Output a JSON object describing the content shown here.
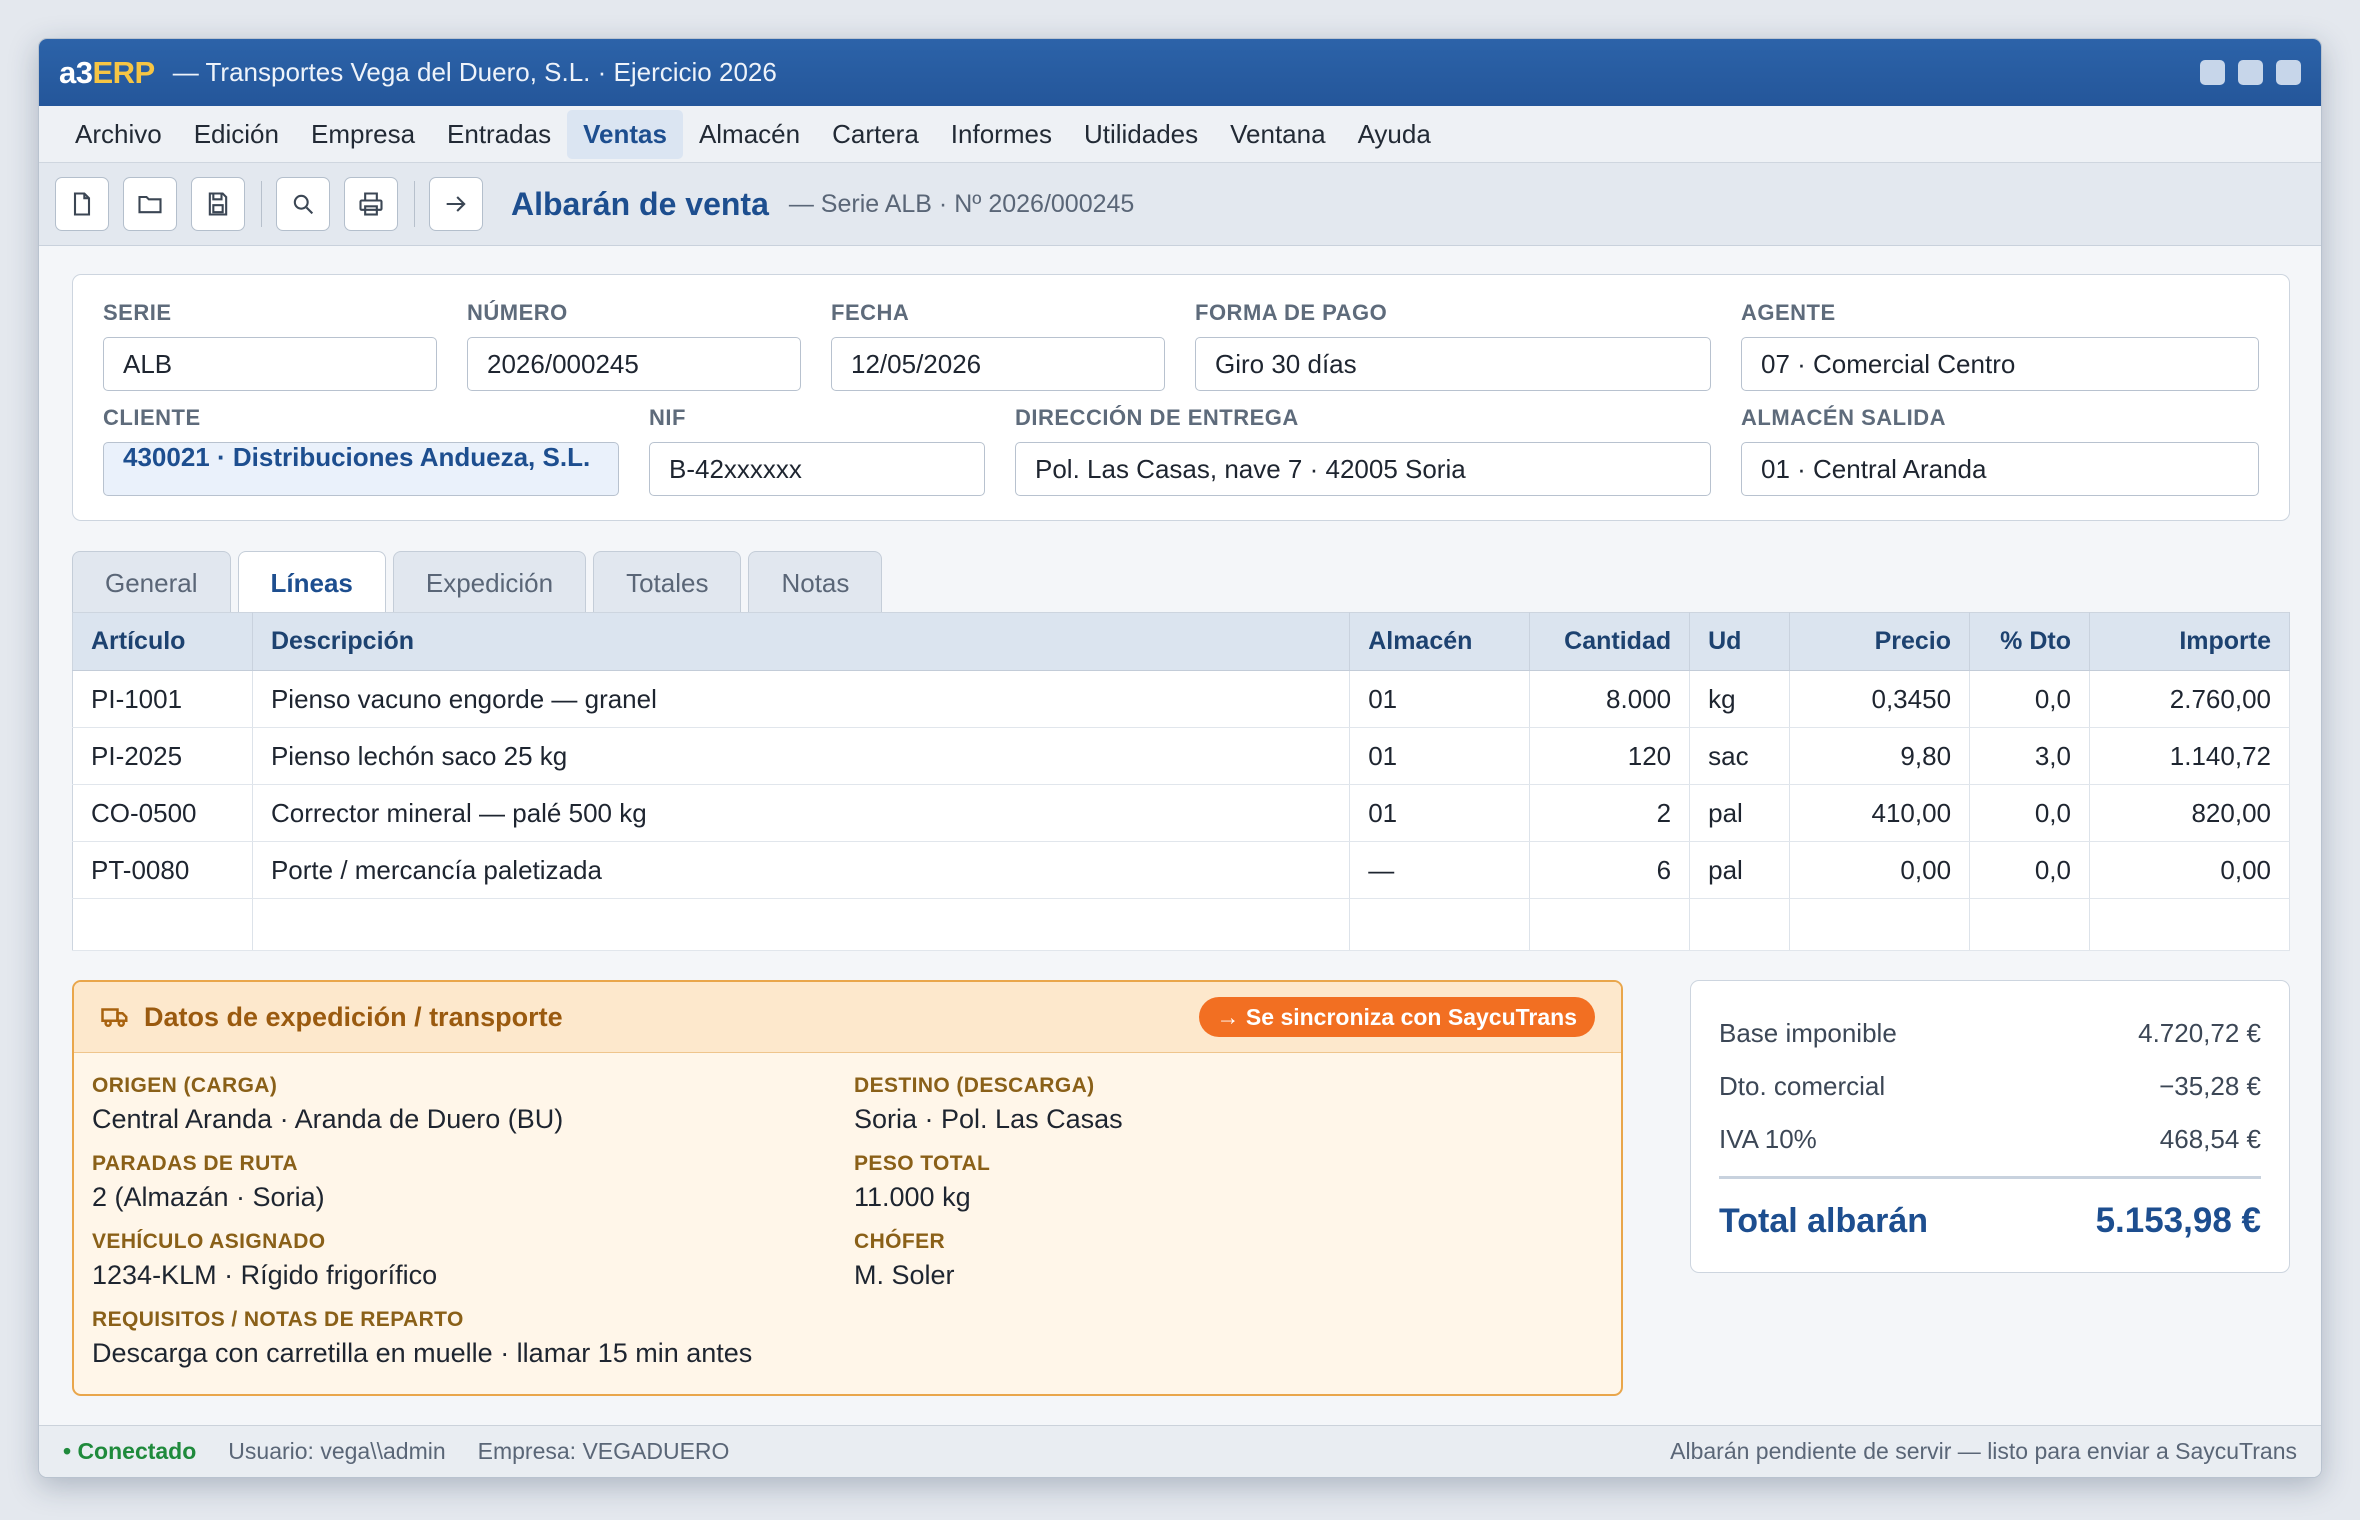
{
  "app": {
    "logo_a3": "a3",
    "logo_erp": "ERP",
    "window_title": "— Transportes Vega del Duero, S.L. · Ejercicio 2026"
  },
  "menu": [
    "Archivo",
    "Edición",
    "Empresa",
    "Entradas",
    "Ventas",
    "Almacén",
    "Cartera",
    "Informes",
    "Utilidades",
    "Ventana",
    "Ayuda"
  ],
  "menu_active": "Ventas",
  "toolbar": {
    "icons": [
      "new-document-icon",
      "open-folder-icon",
      "save-icon",
      "search-icon",
      "print-icon",
      "forward-arrow-icon"
    ],
    "doc_title": "Albarán de venta",
    "doc_sub": "— Serie ALB · Nº 2026/000245"
  },
  "header": {
    "serie_label": "SERIE",
    "serie": "ALB",
    "numero_label": "NÚMERO",
    "numero": "2026/000245",
    "fecha_label": "FECHA",
    "fecha": "12/05/2026",
    "forma_pago_label": "FORMA DE PAGO",
    "forma_pago": "Giro 30 días",
    "agente_label": "AGENTE",
    "agente": "07 · Comercial Centro",
    "cliente_label": "CLIENTE",
    "cliente": "430021 · Distribuciones Andueza, S.L.",
    "nif_label": "NIF",
    "nif": "B-42xxxxxx",
    "direccion_label": "DIRECCIÓN DE ENTREGA",
    "direccion": "Pol. Las Casas, nave 7 · 42005 Soria",
    "almacen_label": "ALMACÉN SALIDA",
    "almacen": "01 · Central Aranda"
  },
  "tabs": [
    "General",
    "Líneas",
    "Expedición",
    "Totales",
    "Notas"
  ],
  "tab_active": "Líneas",
  "lines": {
    "columns": [
      "Artículo",
      "Descripción",
      "Almacén",
      "Cantidad",
      "Ud",
      "Precio",
      "% Dto",
      "Importe"
    ],
    "rows": [
      [
        "PI-1001",
        "Pienso vacuno engorde — granel",
        "01",
        "8.000",
        "kg",
        "0,3450",
        "0,0",
        "2.760,00"
      ],
      [
        "PI-2025",
        "Pienso lechón saco 25 kg",
        "01",
        "120",
        "sac",
        "9,80",
        "3,0",
        "1.140,72"
      ],
      [
        "CO-0500",
        "Corrector mineral — palé 500 kg",
        "01",
        "2",
        "pal",
        "410,00",
        "0,0",
        "820,00"
      ],
      [
        "PT-0080",
        "Porte / mercancía paletizada",
        "—",
        "6",
        "pal",
        "0,00",
        "0,0",
        "0,00"
      ]
    ]
  },
  "shipping": {
    "title": "Datos de expedición / transporte",
    "sync_badge": "→ Se sincroniza con SaycuTrans",
    "origen_label": "ORIGEN (CARGA)",
    "origen": "Central Aranda · Aranda de Duero (BU)",
    "destino_label": "DESTINO (DESCARGA)",
    "destino": "Soria · Pol. Las Casas",
    "paradas_label": "PARADAS DE RUTA",
    "paradas": "2 (Almazán · Soria)",
    "peso_label": "PESO TOTAL",
    "peso": "11.000 kg",
    "vehiculo_label": "VEHÍCULO ASIGNADO",
    "vehiculo": "1234-KLM · Rígido frigorífico",
    "chofer_label": "CHÓFER",
    "chofer": "M. Soler",
    "requisitos_label": "REQUISITOS / NOTAS DE REPARTO",
    "requisitos": "Descarga con carretilla en muelle · llamar 15 min antes"
  },
  "totals": {
    "base_label": "Base imponible",
    "base": "4.720,72 €",
    "dto_label": "Dto. comercial",
    "dto": "−35,28 €",
    "iva_label": "IVA 10%",
    "iva": "468,54 €",
    "total_label": "Total albarán",
    "total": "5.153,98 €"
  },
  "status": {
    "connected": "• Conectado",
    "user": "Usuario: vega\\\\admin",
    "company": "Empresa: VEGADUERO",
    "message": "Albarán pendiente de servir — listo para enviar a SaycuTrans"
  },
  "colors": {
    "brand": "#24569a",
    "accent_erp": "#f6c544",
    "sync_badge": "#f26f22",
    "connected": "#1f8a3c"
  }
}
